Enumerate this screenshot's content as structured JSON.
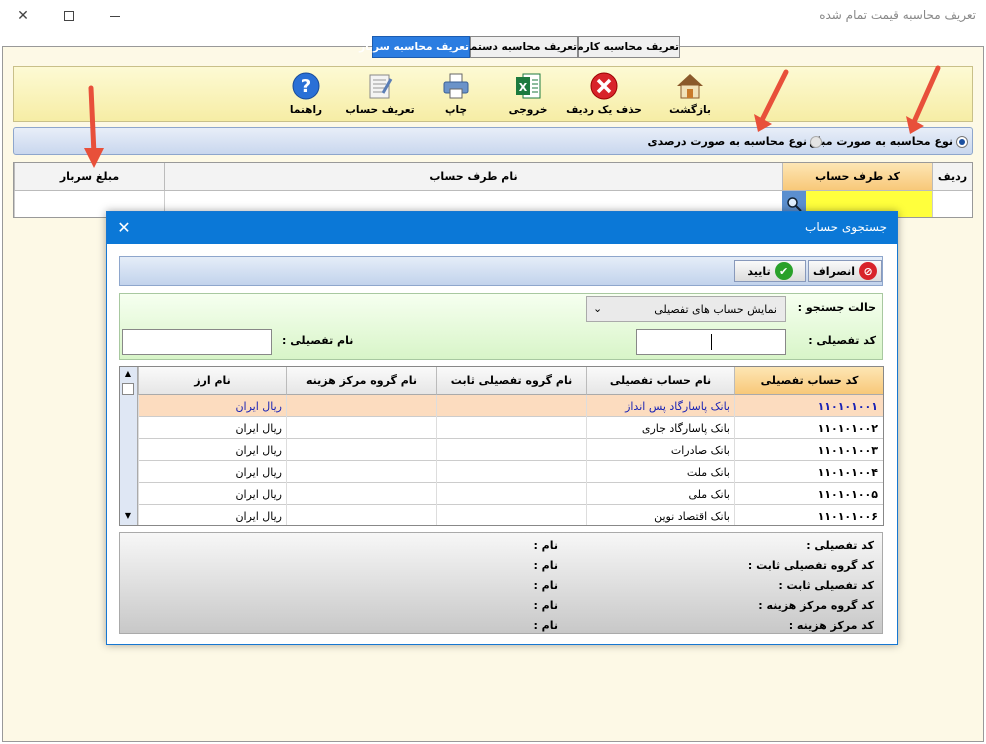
{
  "window": {
    "title": "تعریف محاسبه قیمت تمام شده",
    "minimize_icon": "minimize-icon",
    "maximize_icon": "maximize-icon",
    "close_icon": "close-icon"
  },
  "tabs": [
    {
      "label": "تعریف محاسبه کارمزد",
      "active": false
    },
    {
      "label": "تعریف محاسبه دستمزد",
      "active": false
    },
    {
      "label": "تعریف محاسبه سربار",
      "active": true
    }
  ],
  "toolbar": {
    "buttons": [
      {
        "label": "بازگشت",
        "icon": "home-icon"
      },
      {
        "label": "حذف یک ردیف",
        "icon": "delete-row-icon"
      },
      {
        "label": "خروجی",
        "icon": "excel-icon"
      },
      {
        "label": "چاپ",
        "icon": "printer-icon"
      },
      {
        "label": "تعریف حساب",
        "icon": "define-account-icon"
      },
      {
        "label": "راهنما",
        "icon": "help-icon"
      }
    ]
  },
  "calc_type": {
    "amount_label": "نوع محاسبه به صورت مبلغ",
    "percent_label": "نوع محاسبه به صورت درصدی",
    "selected": "amount"
  },
  "main_grid": {
    "headers": {
      "row": "ردیف",
      "account_code": "کد طرف حساب",
      "account_name": "نام طرف حساب",
      "overhead_amount": "مبلغ سربار"
    }
  },
  "dialog": {
    "title": "جستجوی حساب",
    "cancel_label": "انصراف",
    "confirm_label": "تایید",
    "search_mode_label": "حالت جستجو :",
    "search_mode_value": "نمایش حساب های تفصیلی",
    "detail_code_label": "کد تفصیلی :",
    "detail_name_label": "نام تفصیلی :",
    "grid": {
      "headers": [
        "کد حساب تفصیلی",
        "نام حساب تفصیلی",
        "نام گروه تفصیلی ثابت",
        "نام گروه مرکز هزینه",
        "نام ارز"
      ],
      "rows": [
        {
          "code": "۱۱۰۱۰۱۰۰۱",
          "name": "بانک پاسارگاد پس انداز",
          "fixed_group": "",
          "cost_group": "",
          "currency": "ریال ایران",
          "selected": true
        },
        {
          "code": "۱۱۰۱۰۱۰۰۲",
          "name": "بانک پاسارگاد جاری",
          "fixed_group": "",
          "cost_group": "",
          "currency": "ریال ایران",
          "selected": false
        },
        {
          "code": "۱۱۰۱۰۱۰۰۳",
          "name": "بانک صادرات",
          "fixed_group": "",
          "cost_group": "",
          "currency": "ریال ایران",
          "selected": false
        },
        {
          "code": "۱۱۰۱۰۱۰۰۴",
          "name": "بانک ملت",
          "fixed_group": "",
          "cost_group": "",
          "currency": "ریال ایران",
          "selected": false
        },
        {
          "code": "۱۱۰۱۰۱۰۰۵",
          "name": "بانک ملی",
          "fixed_group": "",
          "cost_group": "",
          "currency": "ریال ایران",
          "selected": false
        },
        {
          "code": "۱۱۰۱۰۱۰۰۶",
          "name": "بانک اقتصاد نوین",
          "fixed_group": "",
          "cost_group": "",
          "currency": "ریال ایران",
          "selected": false
        }
      ]
    },
    "info": {
      "rows": [
        {
          "left": "کد تفصیلی :",
          "right": "نام :"
        },
        {
          "left": "کد گروه تفصیلی ثابت :",
          "right": "نام :"
        },
        {
          "left": "کد تفصیلی ثابت :",
          "right": "نام :"
        },
        {
          "left": "کد گروه مرکز هزینه :",
          "right": "نام :"
        },
        {
          "left": "کد مرکز هزینه :",
          "right": "نام :"
        }
      ]
    }
  },
  "colors": {
    "accent": "#0b78d7",
    "arrow": "#e8503a",
    "selected_row": "#fcdcbf",
    "yellow_cell": "#ffff3c"
  }
}
